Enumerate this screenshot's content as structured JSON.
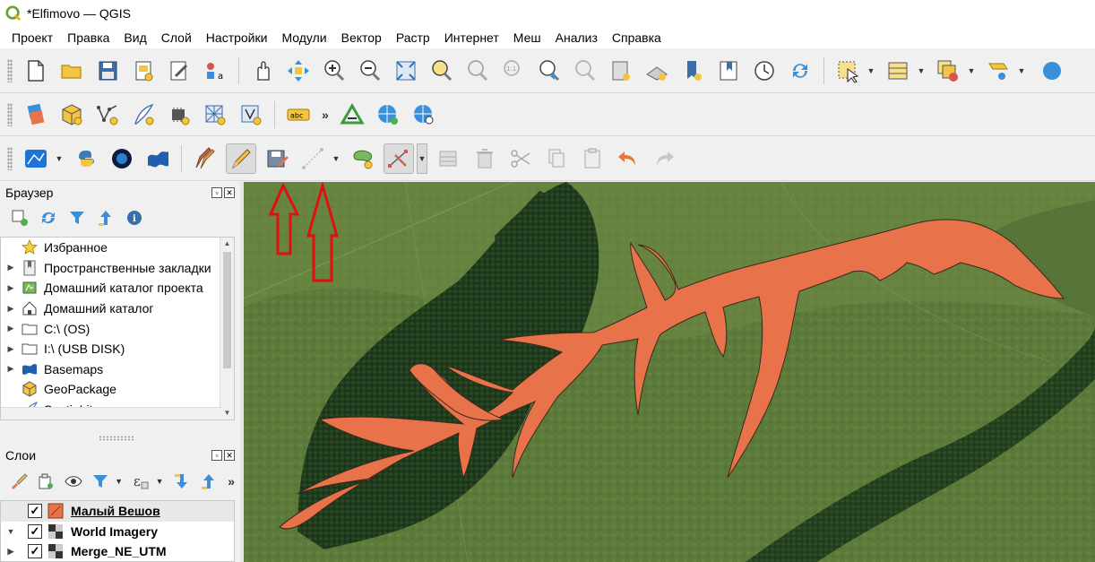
{
  "window": {
    "title": "*Elfimovo — QGIS"
  },
  "menu": [
    "Проект",
    "Правка",
    "Вид",
    "Слой",
    "Настройки",
    "Модули",
    "Вектор",
    "Растр",
    "Интернет",
    "Меш",
    "Анализ",
    "Справка"
  ],
  "toolbar2": {
    "label_tool_text": "abc",
    "overflow": "»"
  },
  "browser_panel": {
    "title": "Браузер",
    "items": [
      {
        "label": "Избранное",
        "icon": "star-icon",
        "expandable": false
      },
      {
        "label": "Пространственные закладки",
        "icon": "bookmark-icon",
        "expandable": true
      },
      {
        "label": "Домашний каталог проекта",
        "icon": "project-home-icon",
        "expandable": true
      },
      {
        "label": "Домашний каталог",
        "icon": "home-icon",
        "expandable": true
      },
      {
        "label": "C:\\ (OS)",
        "icon": "folder-icon",
        "expandable": true
      },
      {
        "label": "I:\\ (USB DISK)",
        "icon": "folder-icon",
        "expandable": true
      },
      {
        "label": "Basemaps",
        "icon": "basemaps-icon",
        "expandable": true
      },
      {
        "label": "GeoPackage",
        "icon": "geopackage-icon",
        "expandable": false
      },
      {
        "label": "SpatiaLite",
        "icon": "spatialite-icon",
        "expandable": false
      }
    ]
  },
  "layers_panel": {
    "title": "Слои",
    "overflow": "»",
    "layers": [
      {
        "name": "Малый Вешов",
        "checked": true,
        "type": "polygon",
        "active": true
      },
      {
        "name": "World Imagery",
        "checked": true,
        "type": "raster",
        "active": false
      },
      {
        "name": "Merge_NE_UTM",
        "checked": true,
        "type": "raster",
        "active": false
      }
    ]
  },
  "colors": {
    "polygon_fill": "#e8734a",
    "annotation_arrow": "#e01010",
    "forest": "#1f3a1c",
    "field": "#5c7a3a"
  }
}
